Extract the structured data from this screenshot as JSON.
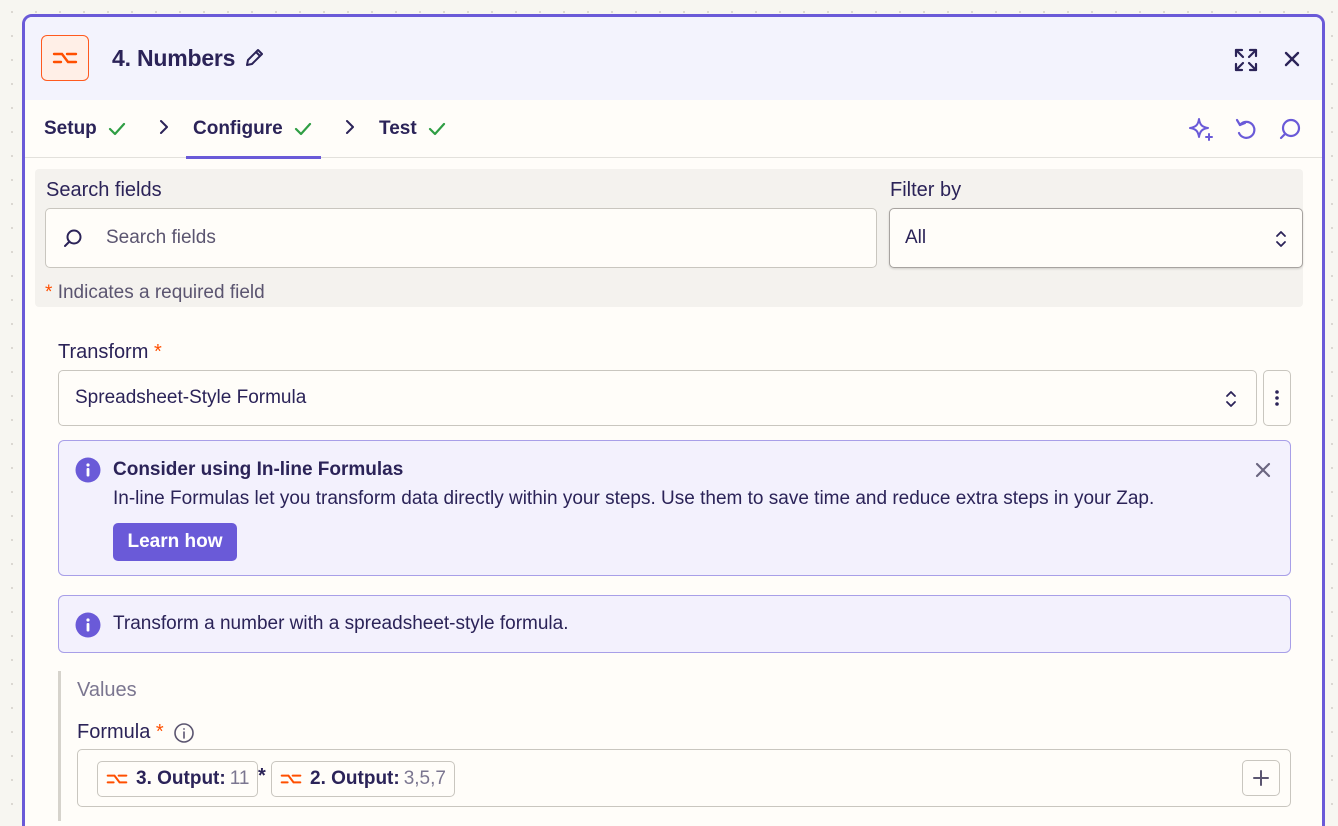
{
  "header": {
    "title": "4. Numbers",
    "app_icon": "formatter-icon",
    "edit_icon": "pencil-icon",
    "expand_icon": "expand-icon",
    "close_icon": "close-icon"
  },
  "tabs": [
    {
      "label": "Setup",
      "status": "complete"
    },
    {
      "label": "Configure",
      "status": "complete",
      "active": true
    },
    {
      "label": "Test",
      "status": "complete"
    }
  ],
  "toolbar_icons": [
    "sparkle-icon",
    "undo-icon",
    "comment-icon"
  ],
  "search": {
    "label": "Search fields",
    "placeholder": "Search fields"
  },
  "filter": {
    "label": "Filter by",
    "value": "All"
  },
  "required_note": {
    "marker": "*",
    "text": "Indicates a required field"
  },
  "transform": {
    "label": "Transform",
    "required_marker": "*",
    "value": "Spreadsheet-Style Formula"
  },
  "inline_notice": {
    "title": "Consider using In-line Formulas",
    "body": "In-line Formulas let you transform data directly within your steps. Use them to save time and reduce extra steps in your Zap.",
    "button": "Learn how"
  },
  "help_notice": {
    "body": "Transform a number with a spreadsheet-style formula."
  },
  "values": {
    "title": "Values",
    "formula": {
      "label": "Formula",
      "required_marker": "*",
      "tokens": [
        {
          "key": "3. Output:",
          "value": "11"
        },
        {
          "operator": "*"
        },
        {
          "key": "2. Output:",
          "value": "3,5,7"
        }
      ]
    }
  },
  "colors": {
    "accent": "#6a5ad8",
    "brand_orange": "#ff4f00",
    "success": "#2f9e44",
    "text": "#2b2358"
  }
}
